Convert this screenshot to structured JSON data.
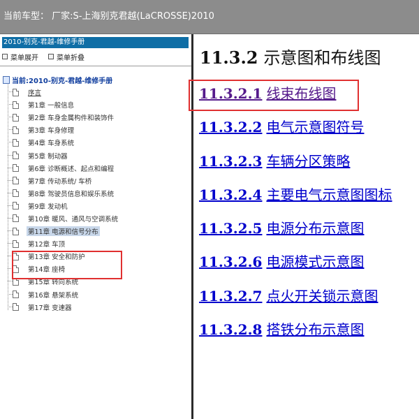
{
  "header": {
    "car_label": "当前车型：  厂家:S-上海别克君越(LaCROSSE)2010"
  },
  "sidebar": {
    "title": "2010-别克-君越-维修手册",
    "toolbar": {
      "expand_label": "菜单展开",
      "collapse_label": "菜单折叠"
    },
    "root_label": "当前:2010-别克-君越-维修手册",
    "items": [
      {
        "label": "序言"
      },
      {
        "label": "第1章  一般信息"
      },
      {
        "label": "第2章  车身金属构件和装饰件"
      },
      {
        "label": "第3章  车身修理"
      },
      {
        "label": "第4章  车身系统"
      },
      {
        "label": "第5章  制动器"
      },
      {
        "label": "第6章  诊断概述、起点和编程"
      },
      {
        "label": "第7章  传动系统/ 车桥"
      },
      {
        "label": "第8章  驾驶员信息和娱乐系统"
      },
      {
        "label": "第9章  发动机"
      },
      {
        "label": "第10章  暖风、通风与空调系统"
      },
      {
        "label": "第11章  电源和信号分布"
      },
      {
        "label": "第12章  车顶"
      },
      {
        "label": "第13章  安全和防护"
      },
      {
        "label": "第14章  座椅"
      },
      {
        "label": "第15章  转向系统"
      },
      {
        "label": "第16章  悬架系统"
      },
      {
        "label": "第17章  变速器"
      }
    ]
  },
  "content": {
    "heading_num": "11.3.2",
    "heading_text": "示意图和布线图",
    "links": [
      {
        "num": "11.3.2.1",
        "text": "线束布线图"
      },
      {
        "num": "11.3.2.2",
        "text": "电气示意图符号"
      },
      {
        "num": "11.3.2.3",
        "text": "车辆分区策略"
      },
      {
        "num": "11.3.2.4",
        "text": "主要电气示意图图标"
      },
      {
        "num": "11.3.2.5",
        "text": "电源分布示意图"
      },
      {
        "num": "11.3.2.6",
        "text": "电源模式示意图"
      },
      {
        "num": "11.3.2.7",
        "text": "点火开关锁示意图"
      },
      {
        "num": "11.3.2.8",
        "text": "搭铁分布示意图"
      }
    ]
  },
  "colors": {
    "topbar": "#8c8c8c",
    "sidebar_header": "#0f6ea6",
    "link": "#0000cc",
    "visited_link": "#551a8b",
    "highlight_box": "#e03030",
    "selected_item": "#c8d7ea"
  }
}
